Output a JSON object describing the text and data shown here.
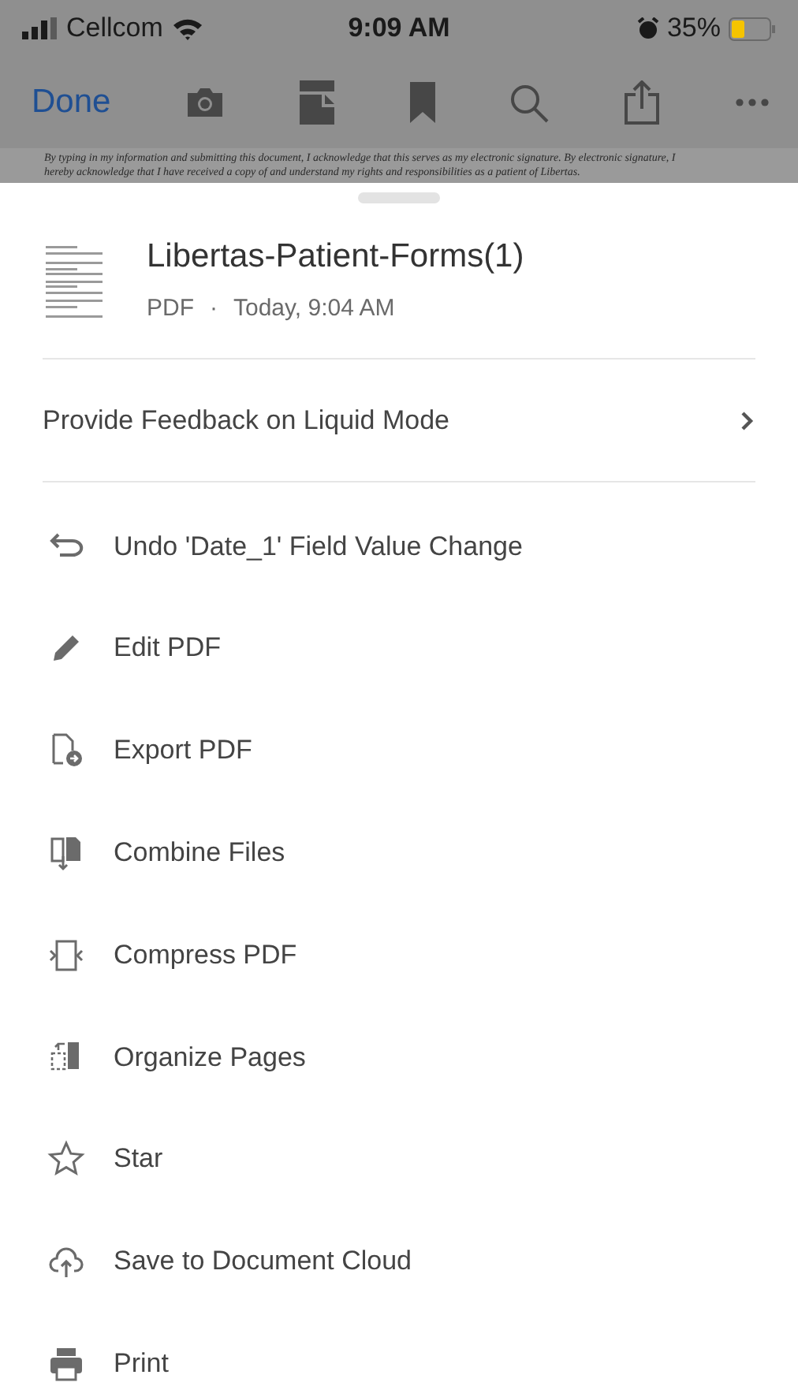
{
  "status_bar": {
    "carrier": "Cellcom",
    "time": "9:09 AM",
    "battery": "35%"
  },
  "toolbar": {
    "done": "Done"
  },
  "document_text": [
    "By typing in my information and submitting this document, I acknowledge that this serves as my electronic signature. By electronic signature, I",
    "hereby acknowledge that I have received a copy of and understand my rights and responsibilities as a patient of Libertas."
  ],
  "file": {
    "name": "Libertas-Patient-Forms(1)",
    "type": "PDF",
    "separator": "·",
    "modified": "Today, 9:04 AM"
  },
  "feedback": {
    "label": "Provide Feedback on Liquid Mode"
  },
  "menu_items": [
    {
      "kind": "undo",
      "label": "Undo 'Date_1' Field Value Change"
    },
    {
      "kind": "edit",
      "label": "Edit PDF"
    },
    {
      "kind": "export",
      "label": "Export PDF"
    },
    {
      "kind": "combine",
      "label": "Combine Files"
    },
    {
      "kind": "compress",
      "label": "Compress PDF"
    },
    {
      "kind": "organize",
      "label": "Organize Pages"
    },
    {
      "kind": "star",
      "label": "Star"
    },
    {
      "kind": "cloud",
      "label": "Save to Document Cloud"
    },
    {
      "kind": "print",
      "label": "Print"
    }
  ]
}
